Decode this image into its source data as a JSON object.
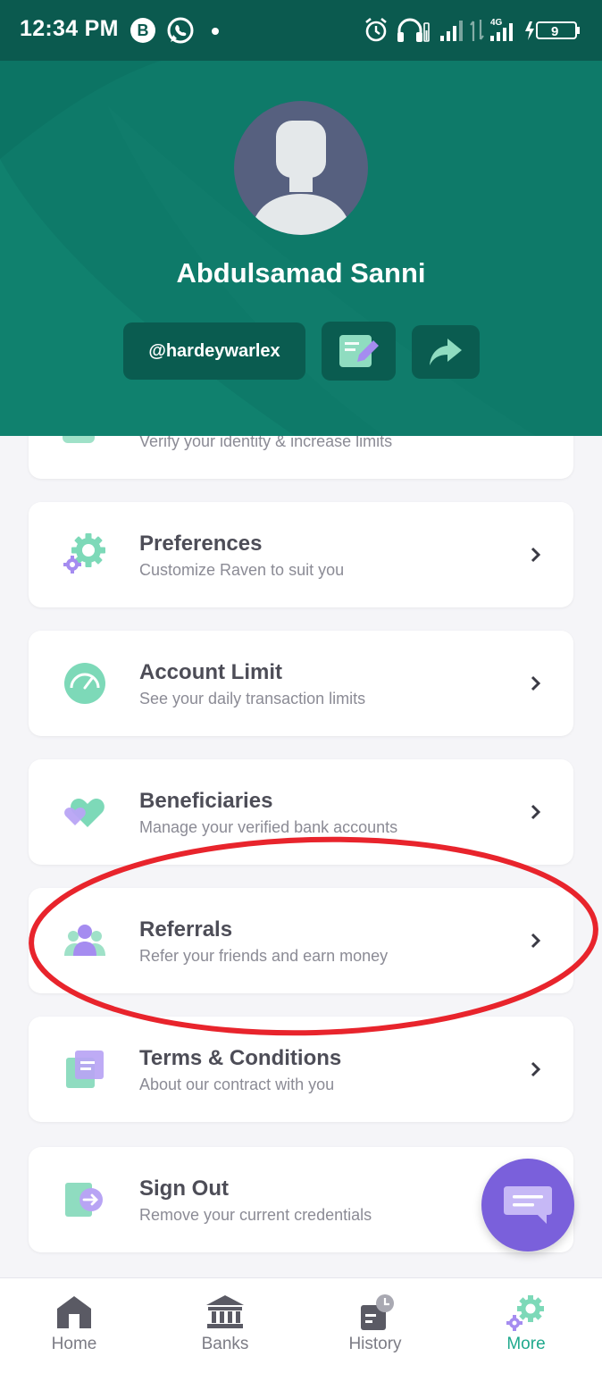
{
  "status_bar": {
    "time": "12:34 PM",
    "b_badge": "B",
    "network": "4G",
    "battery": "9"
  },
  "profile": {
    "name": "Abdulsamad Sanni",
    "handle": "@hardeywarlex"
  },
  "menu": {
    "partial_item_subtitle": "Verify your identity & increase limits",
    "items": [
      {
        "title": "Preferences",
        "subtitle": "Customize Raven to suit you"
      },
      {
        "title": "Account Limit",
        "subtitle": "See your daily transaction limits"
      },
      {
        "title": "Beneficiaries",
        "subtitle": "Manage your verified bank accounts"
      },
      {
        "title": "Referrals",
        "subtitle": "Refer your friends and earn money"
      },
      {
        "title": "Terms & Conditions",
        "subtitle": "About our contract with you"
      },
      {
        "title": "Sign Out",
        "subtitle": "Remove your current credentials"
      }
    ]
  },
  "bottom_nav": [
    {
      "label": "Home",
      "icon": "home-icon"
    },
    {
      "label": "Banks",
      "icon": "bank-icon"
    },
    {
      "label": "History",
      "icon": "history-icon"
    },
    {
      "label": "More",
      "icon": "gear-icon",
      "active": true
    }
  ],
  "colors": {
    "header": "#0e7a69",
    "status_bar": "#0b5a4f",
    "accent_green": "#7dd9b8",
    "accent_purple": "#8a6fe8",
    "active_nav": "#20a98d",
    "highlight_ring": "#e8242c"
  }
}
